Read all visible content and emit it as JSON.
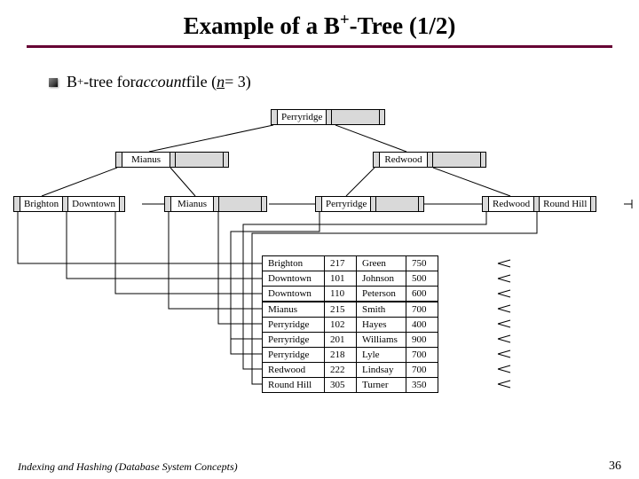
{
  "title": {
    "pre": "Example of a B",
    "sup": "+",
    "post": "-Tree (1/2)"
  },
  "bullet": {
    "b": "B",
    "sup": "+",
    "mid": "-tree for ",
    "account": "account",
    "file": " file (",
    "n": "n",
    "eq3": " = 3",
    "close": ")"
  },
  "root": {
    "k1": "Perryridge",
    "k2": ""
  },
  "int": {
    "left": {
      "k1": "Mianus",
      "k2": ""
    },
    "right": {
      "k1": "Redwood",
      "k2": ""
    }
  },
  "leaves": {
    "l1": {
      "k1": "Brighton",
      "k2": "Downtown"
    },
    "l2": {
      "k1": "Mianus",
      "k2": ""
    },
    "l3": {
      "k1": "Perryridge",
      "k2": ""
    },
    "l4": {
      "k1": "Redwood",
      "k2": "Round Hill"
    }
  },
  "table": [
    {
      "branch": "Brighton",
      "acct": "217",
      "name": "Green",
      "bal": "750"
    },
    {
      "branch": "Downtown",
      "acct": "101",
      "name": "Johnson",
      "bal": "500"
    },
    {
      "branch": "Downtown",
      "acct": "110",
      "name": "Peterson",
      "bal": "600"
    },
    {
      "branch": "Mianus",
      "acct": "215",
      "name": "Smith",
      "bal": "700"
    },
    {
      "branch": "Perryridge",
      "acct": "102",
      "name": "Hayes",
      "bal": "400"
    },
    {
      "branch": "Perryridge",
      "acct": "201",
      "name": "Williams",
      "bal": "900"
    },
    {
      "branch": "Perryridge",
      "acct": "218",
      "name": "Lyle",
      "bal": "700"
    },
    {
      "branch": "Redwood",
      "acct": "222",
      "name": "Lindsay",
      "bal": "700"
    },
    {
      "branch": "Round Hill",
      "acct": "305",
      "name": "Turner",
      "bal": "350"
    }
  ],
  "footer": "Indexing and Hashing (Database System Concepts)",
  "pagenum": "36"
}
